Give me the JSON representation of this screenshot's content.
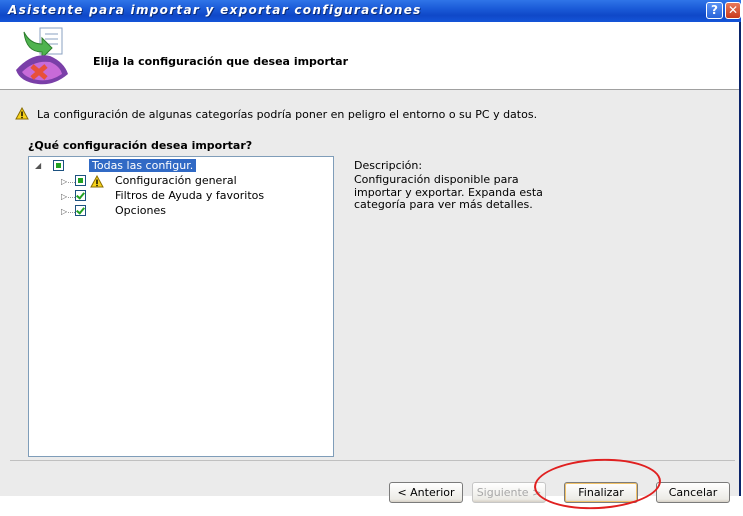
{
  "window": {
    "title": "Asistente para importar y exportar configuraciones",
    "help_glyph": "?",
    "close_glyph": "✕"
  },
  "header": {
    "title": "Elija la configuración que desea importar"
  },
  "warning": {
    "text": "La configuración de algunas categorías podría poner en peligro el entorno o su PC y datos."
  },
  "question": "¿Qué configuración desea importar?",
  "tree": {
    "items": [
      {
        "label": "Todas las configur.",
        "state": "partial",
        "expanded": true,
        "selected": true
      },
      {
        "label": "Configuración general",
        "state": "partial",
        "warning": true
      },
      {
        "label": "Filtros de Ayuda y favoritos",
        "state": "checked"
      },
      {
        "label": "Opciones",
        "state": "checked"
      }
    ]
  },
  "description": {
    "label": "Descripción:",
    "text": "Configuración disponible para importar y exportar. Expanda esta categoría para ver más detalles."
  },
  "buttons": {
    "back": "< Anterior",
    "next": "Siguiente >",
    "finish": "Finalizar",
    "cancel": "Cancelar"
  },
  "colors": {
    "titlebar": "#1a5ad7",
    "selection": "#316ac5",
    "annotation_circle": "#e02020"
  }
}
